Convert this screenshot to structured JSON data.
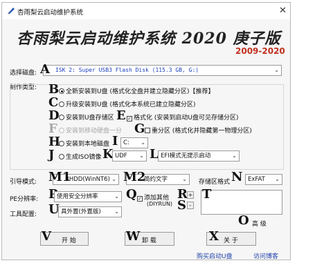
{
  "window": {
    "title": "杏雨梨云启动维护系统",
    "close_glyph": "✕"
  },
  "banner": {
    "title": "杏雨梨云启动维护系统 2020 庚子版",
    "years": "2009-2020"
  },
  "disk": {
    "label": "选择磁盘:",
    "marker": "A",
    "value": "ISK 2: Super USB3 Flash Disk (115.3 GB, G:)"
  },
  "mode": {
    "label": "制作类型:",
    "options": [
      {
        "marker": "B",
        "label": "全新安装到U盘 (格式化全盘并建立隐藏分区)【推荐】",
        "selected": true
      },
      {
        "marker": "C",
        "label": "升级安装到U盘 (格式化本系统已建立隐藏分区)"
      },
      {
        "marker": "D",
        "label": "安装到U盘存储区"
      },
      {
        "marker": "F",
        "label": "安装到移动硬盘一分"
      },
      {
        "marker": "H",
        "label": "安装到本地磁盘"
      },
      {
        "marker": "J",
        "label": "生成ISO镜像"
      }
    ],
    "format_marker": "E",
    "format_label": "格式化 (安装到启动U盘可见存储分区)",
    "repart_marker": "G",
    "repart_label": "重分区 (格式化并隐藏第一物理分区)",
    "local_marker": "I",
    "local_value": "C:",
    "iso_marker": "K",
    "iso_value": "UDF",
    "uefi_marker": "L",
    "uefi_value": "EFI模式无提示启动"
  },
  "boot": {
    "label": "引导模式:",
    "marker": "M1",
    "value": "BHDD(WinNT6)",
    "marker2": "M2",
    "value2": "简约文字",
    "fmt_label": "存储区格式",
    "fmt_marker": "N",
    "fmt_value": "ExFAT"
  },
  "pe": {
    "label": "PE分辨率:",
    "marker": "P",
    "value": "使用安全分辨率",
    "other_marker": "Q",
    "other_label": "添加其他",
    "other_sub": "(DIYRUN)",
    "r_marker": "R",
    "r_glyph": "+",
    "s_marker": "S",
    "s_glyph": "-",
    "t_marker": "T"
  },
  "tools": {
    "label": "工具配置:",
    "marker": "U",
    "value": "具外置(外置版)"
  },
  "advanced": {
    "marker": "O",
    "label": "高 级"
  },
  "buttons": {
    "start_marker": "V",
    "start_label": "开 始",
    "uninstall_marker": "W",
    "uninstall_label": "卸 载",
    "about_marker": "X",
    "about_label": "关 于"
  },
  "links": {
    "buy": "购买启动U盘",
    "blog": "访问博客"
  }
}
